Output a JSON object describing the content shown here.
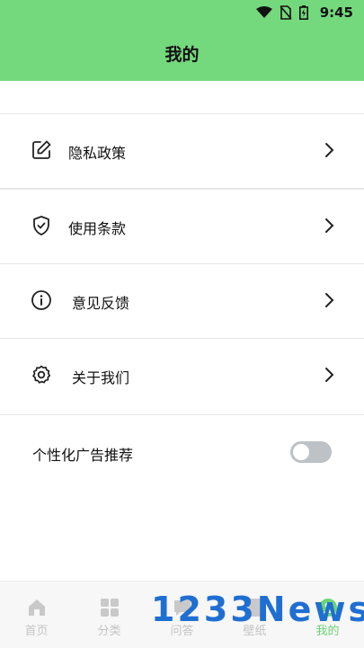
{
  "status": {
    "time": "9:45",
    "icons": [
      "wifi-icon",
      "no-sim-icon",
      "battery-icon"
    ]
  },
  "header": {
    "title": "我的",
    "color": "#74d97d"
  },
  "menu": [
    {
      "label": "隐私政策",
      "icon": "edit-icon"
    },
    {
      "label": "使用条款",
      "icon": "shield-check-icon"
    },
    {
      "label": "意见反馈",
      "icon": "info-icon"
    },
    {
      "label": "关于我们",
      "icon": "gear-icon"
    }
  ],
  "ad": {
    "label": "个性化广告推荐",
    "enabled": false
  },
  "nav": [
    {
      "label": "首页",
      "icon": "home-icon",
      "active": false
    },
    {
      "label": "分类",
      "icon": "grid-icon",
      "active": false
    },
    {
      "label": "问答",
      "icon": "chat-icon",
      "active": false
    },
    {
      "label": "壁纸",
      "icon": "wallpaper-icon",
      "active": false
    },
    {
      "label": "我的",
      "icon": "profile-icon",
      "active": true
    }
  ],
  "watermark": "1233News",
  "colors": {
    "accent": "#74d97d",
    "nav_active": "#6dd473",
    "nav_inactive": "#c4c4c4",
    "watermark": "#1f6fd2"
  }
}
